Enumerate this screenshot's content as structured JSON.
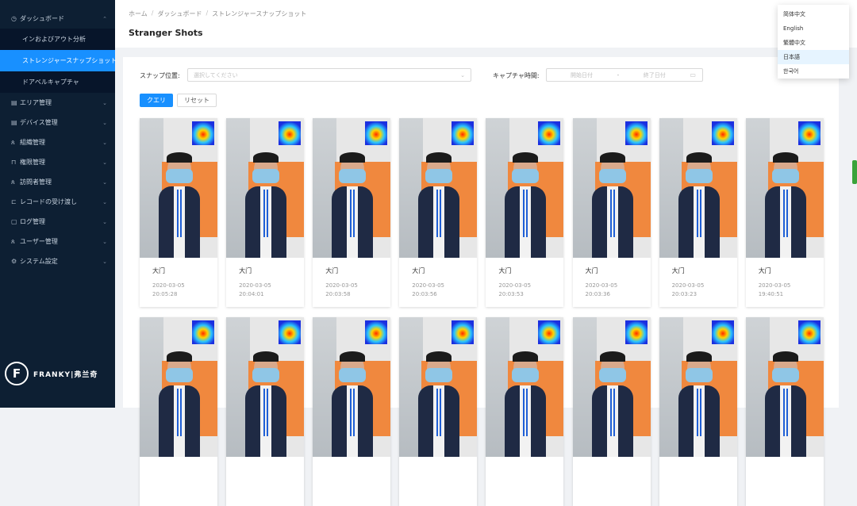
{
  "sidebar": {
    "groups": [
      {
        "label": "ダッシュボード",
        "icon": "dashboard-icon",
        "expanded": true,
        "children": [
          "インおよびアウト分析",
          "ストレンジャースナップショット",
          "ドアベルキャプチャ"
        ]
      },
      {
        "label": "エリア管理",
        "icon": "area-icon"
      },
      {
        "label": "デバイス管理",
        "icon": "device-icon"
      },
      {
        "label": "組織管理",
        "icon": "organization-icon"
      },
      {
        "label": "権限管理",
        "icon": "lock-icon"
      },
      {
        "label": "訪問者管理",
        "icon": "visitor-icon"
      },
      {
        "label": "レコードの受け渡し",
        "icon": "record-icon"
      },
      {
        "label": "ログ管理",
        "icon": "log-icon"
      },
      {
        "label": "ユーザー管理",
        "icon": "user-icon"
      },
      {
        "label": "システム設定",
        "icon": "settings-icon"
      }
    ],
    "active_child": "ストレンジャースナップショット",
    "logo_text": "FRANKY|弗兰奇"
  },
  "header": {
    "breadcrumb": [
      "ホーム",
      "ダッシュボード",
      "ストレンジャースナップショット"
    ],
    "title": "Stranger Shots"
  },
  "filters": {
    "snap_location_label": "スナップ位置:",
    "snap_location_placeholder": "選択してください",
    "capture_time_label": "キャプチャ時間:",
    "start_date_placeholder": "開始日付",
    "date_separator": "-",
    "end_date_placeholder": "終了日付",
    "query_label": "クエリ",
    "reset_label": "リセット"
  },
  "shots": [
    {
      "location": "大门",
      "date": "2020-03-05",
      "time": "20:05:28"
    },
    {
      "location": "大门",
      "date": "2020-03-05",
      "time": "20:04:01"
    },
    {
      "location": "大门",
      "date": "2020-03-05",
      "time": "20:03:58"
    },
    {
      "location": "大门",
      "date": "2020-03-05",
      "time": "20:03:56"
    },
    {
      "location": "大门",
      "date": "2020-03-05",
      "time": "20:03:53"
    },
    {
      "location": "大门",
      "date": "2020-03-05",
      "time": "20:03:36"
    },
    {
      "location": "大门",
      "date": "2020-03-05",
      "time": "20:03:23"
    },
    {
      "location": "大门",
      "date": "2020-03-05",
      "time": "19:40:51"
    },
    {
      "location": "",
      "date": "",
      "time": ""
    },
    {
      "location": "",
      "date": "",
      "time": ""
    },
    {
      "location": "",
      "date": "",
      "time": ""
    },
    {
      "location": "",
      "date": "",
      "time": ""
    },
    {
      "location": "",
      "date": "",
      "time": ""
    },
    {
      "location": "",
      "date": "",
      "time": ""
    },
    {
      "location": "",
      "date": "",
      "time": ""
    },
    {
      "location": "",
      "date": "",
      "time": ""
    }
  ],
  "language_menu": {
    "options": [
      "简体中文",
      "English",
      "繁體中文",
      "日本語",
      "한국어"
    ],
    "selected": "日本語"
  },
  "colors": {
    "sidebar_bg": "#0d1f33",
    "accent": "#1890ff"
  }
}
